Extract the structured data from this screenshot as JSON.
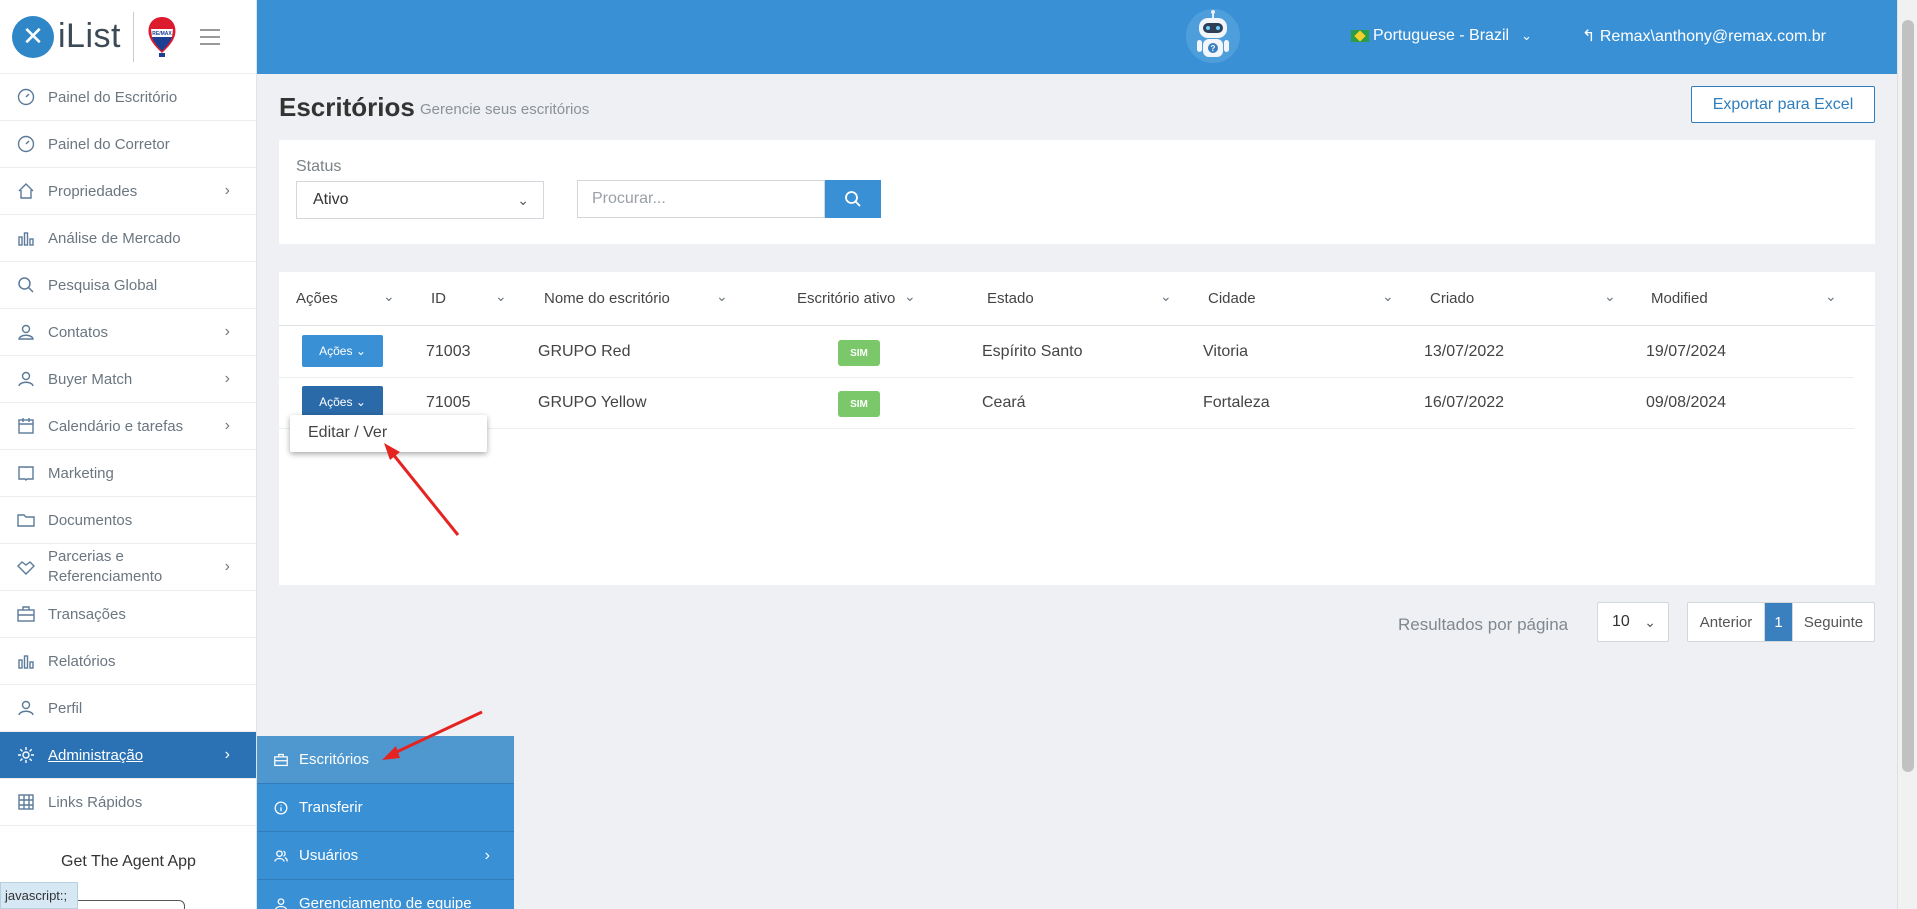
{
  "brand": {
    "logo_text": "iList",
    "partner": "RE/MAX"
  },
  "sidebar": {
    "items": [
      {
        "label": "Painel do Escritório",
        "icon": "gauge-icon",
        "has_children": false
      },
      {
        "label": "Painel do Corretor",
        "icon": "gauge-icon",
        "has_children": false
      },
      {
        "label": "Propriedades",
        "icon": "home-icon",
        "has_children": true
      },
      {
        "label": "Análise de Mercado",
        "icon": "bar-chart-icon",
        "has_children": false
      },
      {
        "label": "Pesquisa Global",
        "icon": "search-icon",
        "has_children": false
      },
      {
        "label": "Contatos",
        "icon": "contacts-icon",
        "has_children": true
      },
      {
        "label": "Buyer Match",
        "icon": "user-icon",
        "has_children": true
      },
      {
        "label": "Calendário e tarefas",
        "icon": "calendar-icon",
        "has_children": true
      },
      {
        "label": "Marketing",
        "icon": "book-icon",
        "has_children": false
      },
      {
        "label": "Documentos",
        "icon": "folder-icon",
        "has_children": false
      },
      {
        "label_line1": "Parcerias e",
        "label_line2": "Referenciamento",
        "icon": "handshake-icon",
        "has_children": true
      },
      {
        "label": "Transações",
        "icon": "briefcase-icon",
        "has_children": false
      },
      {
        "label": "Relatórios",
        "icon": "bar-chart-icon",
        "has_children": false
      },
      {
        "label": "Perfil",
        "icon": "user-icon",
        "has_children": false
      },
      {
        "label": "Administração",
        "icon": "gear-icon",
        "has_children": true,
        "active": true
      },
      {
        "label": "Links Rápidos",
        "icon": "links-icon",
        "has_children": false
      }
    ],
    "agent_app": "Get The Agent App"
  },
  "submenu": {
    "items": [
      {
        "label": "Escritórios",
        "icon": "briefcase-icon",
        "active": true
      },
      {
        "label": "Transferir",
        "icon": "info-icon"
      },
      {
        "label": "Usuários",
        "icon": "users-icon",
        "has_children": true
      },
      {
        "label": "Gerenciamento de equipe",
        "icon": "team-icon"
      }
    ]
  },
  "topbar": {
    "language": "Portuguese - Brazil",
    "user": "Remax\\anthony@remax.com.br"
  },
  "page": {
    "title": "Escritórios",
    "subtitle": "Gerencie seus escritórios",
    "export_label": "Exportar para Excel"
  },
  "filters": {
    "status_label": "Status",
    "status_value": "Ativo",
    "search_placeholder": "Procurar..."
  },
  "table": {
    "columns": [
      "Ações",
      "ID",
      "Nome do escritório",
      "Escritório ativo",
      "Estado",
      "Cidade",
      "Criado",
      "Modified"
    ],
    "action_label": "Ações",
    "rows": [
      {
        "id": "71003",
        "name": "GRUPO Red",
        "active": "SIM",
        "state": "Espírito Santo",
        "city": "Vitoria",
        "created": "13/07/2022",
        "modified": "19/07/2024"
      },
      {
        "id": "71005",
        "name": "GRUPO Yellow",
        "active": "SIM",
        "state": "Ceará",
        "city": "Fortaleza",
        "created": "16/07/2022",
        "modified": "09/08/2024"
      }
    ],
    "dropdown_item": "Editar / Ver"
  },
  "pagination": {
    "results_label": "Resultados por página",
    "per_page": "10",
    "prev": "Anterior",
    "current": "1",
    "next": "Seguinte"
  },
  "statusbar": {
    "text": "javascript:;"
  },
  "colors": {
    "primary": "#3a90d5",
    "active_nav": "#2b72b5",
    "success": "#7ac869"
  }
}
